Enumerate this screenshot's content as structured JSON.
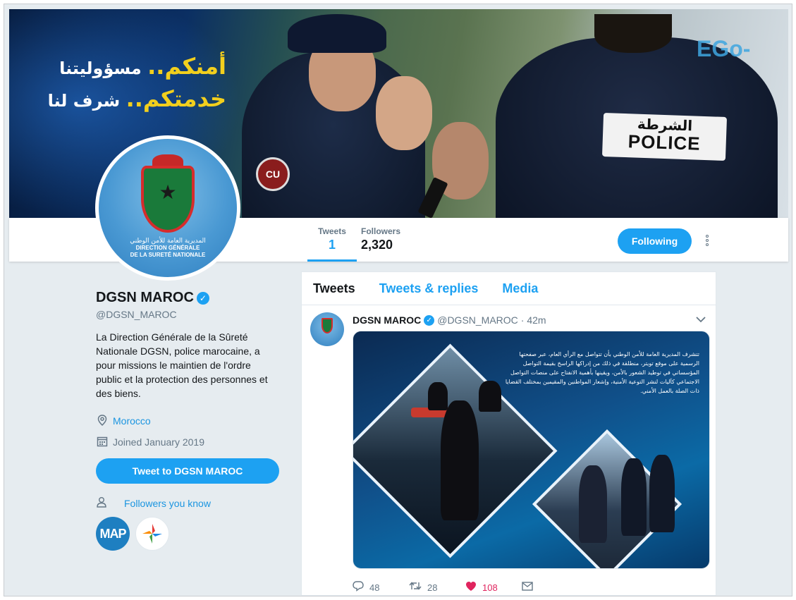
{
  "banner": {
    "slogan_line1_highlight": "أمنكم..",
    "slogan_line1_rest": "مسؤوليتنا",
    "slogan_line2_highlight": "خدمتكم..",
    "slogan_line2_rest": "شرف لنا",
    "patch_arabic": "الشرطة",
    "patch_english": "POLICE",
    "badge_text": "CU",
    "sign_text": "EGo-"
  },
  "avatar": {
    "text_arabic": "المديرية العامة للأمن الوطني",
    "text_line1": "DIRECTION GÉNÉRALE",
    "text_line2": "DE LA SURETÉ NATIONALE"
  },
  "profile_nav": {
    "tweets_label": "Tweets",
    "tweets_count": "1",
    "followers_label": "Followers",
    "followers_count": "2,320",
    "following_button": "Following",
    "accent_color": "#1da1f2"
  },
  "profile": {
    "name": "DGSN MAROC",
    "verified_icon": "✓",
    "handle": "@DGSN_MAROC",
    "bio": "La Direction Générale de la Sûreté Nationale DGSN, police marocaine, a pour missions le maintien de l'ordre public et la protection des personnes et des biens.",
    "location": "Morocco",
    "joined": "Joined January 2019",
    "tweet_to_button": "Tweet to DGSN MAROC",
    "followers_you_know": "Followers you know",
    "fyk_avatar1": "MAP"
  },
  "timeline": {
    "tabs": [
      {
        "label": "Tweets"
      },
      {
        "label": "Tweets & replies"
      },
      {
        "label": "Media"
      }
    ],
    "tweet": {
      "name": "DGSN MAROC",
      "handle": "@DGSN_MAROC",
      "time": "· 42m",
      "media_text": "تتشرف المديرية العامة للأمن الوطني بأن تتواصل مع الرأي العام، عبر صفحتها الرسمية على موقع تويتر، منطلقة في ذلك من إدراكها الراسخ بقيمة التواصل المؤسساتي في توطيد الشعور بالأمن، ويقينها بأهمية الانفتاح على منصات التواصل الاجتماعي كآليات لنشر التوعية الأمنية، وإشعار المواطنين والمقيمين بمختلف القضايا ذات الصلة بالعمل الأمني.",
      "replies": "48",
      "retweets": "28",
      "likes": "108",
      "like_color": "#e0245e"
    }
  }
}
